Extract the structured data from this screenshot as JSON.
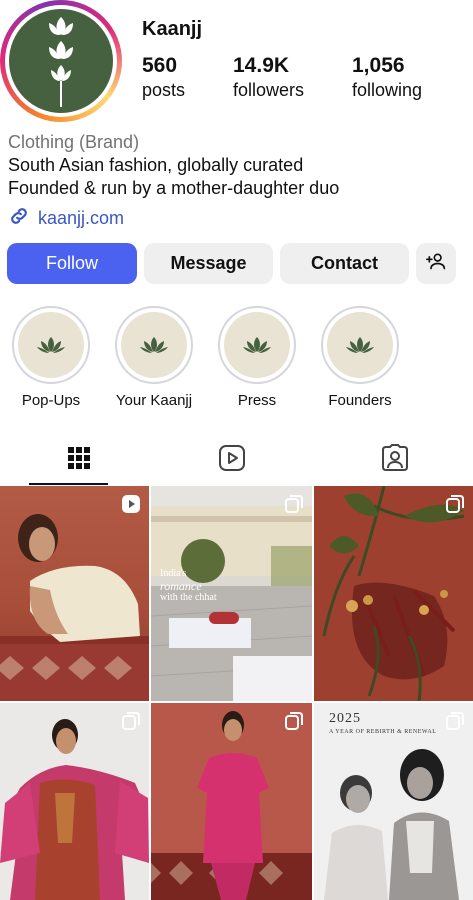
{
  "profile": {
    "username": "Kaanjj",
    "stats": [
      {
        "value": "560",
        "label": "posts"
      },
      {
        "value": "14.9K",
        "label": "followers"
      },
      {
        "value": "1,056",
        "label": "following"
      }
    ],
    "category": "Clothing (Brand)",
    "bio_line1": "South Asian fashion, globally curated",
    "bio_line2": "Founded & run by a mother-daughter duo",
    "link": "kaanjj.com"
  },
  "actions": {
    "follow": "Follow",
    "message": "Message",
    "contact": "Contact"
  },
  "highlights": [
    {
      "label": "Pop-Ups"
    },
    {
      "label": "Your Kaanjj"
    },
    {
      "label": "Press"
    },
    {
      "label": "Founders"
    }
  ],
  "posts": {
    "post2_caption_line1": "India's",
    "post2_caption_line2": "romance",
    "post2_caption_line3": "with the chhat",
    "post6_year": "2025",
    "post6_subtitle": "A YEAR OF REBIRTH & RENEWAL"
  },
  "colors": {
    "brand_green": "#45613f",
    "follow_blue": "#4a62ef",
    "link_blue": "#3a57c7"
  }
}
